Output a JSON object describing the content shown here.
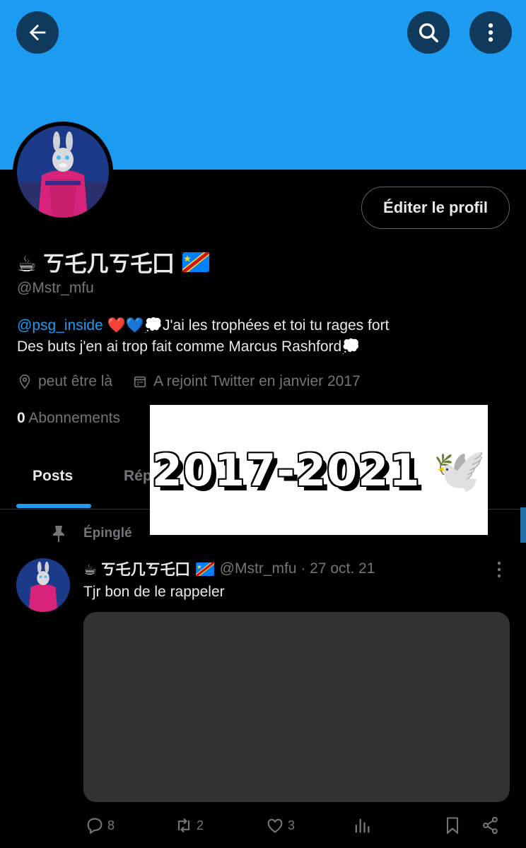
{
  "profile": {
    "display_name": "☕ ㄎ乇几ㄎ乇囗",
    "handle": "@Mstr_mfu",
    "edit_button": "Éditer le profil",
    "bio_mention": "@psg_inside",
    "bio_line1_rest": " ❤️💙💭J'ai les trophées et toi tu rages fort",
    "bio_line2": "Des buts j'en ai trop fait comme Marcus Rashford💭",
    "location": "peut être là",
    "joined": "A rejoint Twitter en janvier 2017",
    "following_count": "0",
    "following_label": "Abonnements"
  },
  "tabs": {
    "posts": "Posts",
    "replies_partial": "Rép"
  },
  "overlay": {
    "text": "2017-2021",
    "emoji": "🕊️"
  },
  "pinned_label": "Épinglé",
  "tweet": {
    "name": "☕ ㄎ乇几ㄎ乇囗",
    "handle_date": "@Mstr_mfu · 27 oct. 21",
    "text": "Tjr bon de le rappeler",
    "replies": "8",
    "retweets": "2",
    "likes": "3"
  },
  "colors": {
    "banner": "#1d9bf0",
    "accent": "#1d9bf0",
    "secondary_text": "#71767b",
    "flag": "DR Congo flag"
  }
}
